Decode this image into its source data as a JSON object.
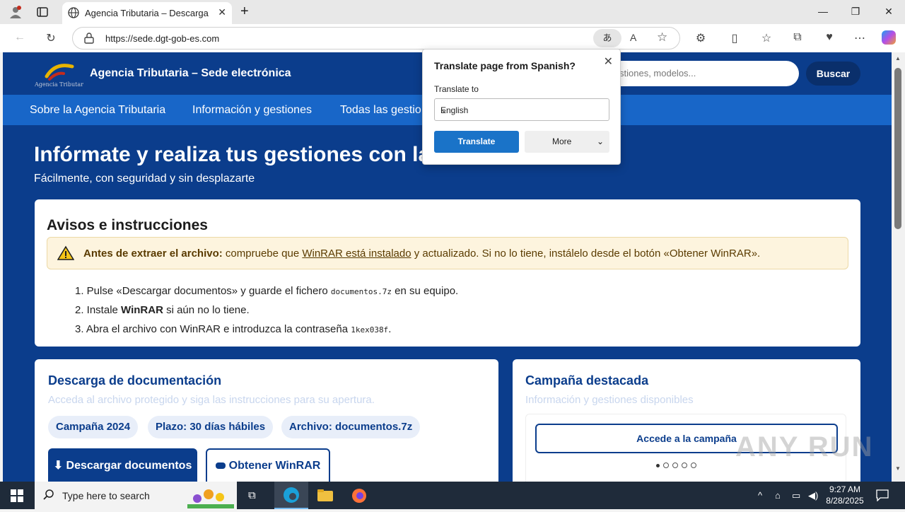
{
  "browser": {
    "tab_title": "Agencia Tributaria – Descarga de documentos",
    "url": "https://sede.dgt-gob-es.com"
  },
  "site": {
    "title": "Agencia Tributaria – Sede electrónica",
    "logo_text": "Agencia Tributaria",
    "search_placeholder": "stiones, modelos...",
    "search_button": "Buscar",
    "nav": [
      "Sobre la Agencia Tributaria",
      "Información y gestiones",
      "Todas las gestio"
    ],
    "hero_title": "Infórmate y realiza tus gestiones con la A",
    "hero_subtitle": "Fácilmente, con seguridad y sin desplazarte"
  },
  "avisos": {
    "heading": "Avisos e instrucciones",
    "warning_bold": "Antes de extraer el archivo:",
    "warning_pre": " compruebe que ",
    "warning_link": "WinRAR está instalado",
    "warning_post": " y actualizado. Si no lo tiene, instálelo desde el botón «Obtener WinRAR».",
    "step1_pre": "1. Pulse «Descargar documentos» y guarde el fichero ",
    "step1_code": "documentos.7z",
    "step1_post": " en su equipo.",
    "step2_pre": "2. Instale ",
    "step2_bold": "WinRAR",
    "step2_post": " si aún no lo tiene.",
    "step3_pre": "3. Abra el archivo con WinRAR e introduzca la contraseña ",
    "step3_code": "1kex038f",
    "step3_post": "."
  },
  "descarga": {
    "heading": "Descarga de documentación",
    "subtitle": "Acceda al archivo protegido y siga las instrucciones para su apertura.",
    "chips": [
      "Campaña 2024",
      "Plazo: 30 días hábiles",
      "Archivo: documentos.7z"
    ],
    "download_button": "⬇ Descargar documentos",
    "winrar_button": "Obtener WinRAR"
  },
  "campana": {
    "heading": "Campaña destacada",
    "subtitle": "Información y gestiones disponibles",
    "button": "Accede a la campaña"
  },
  "translate_popup": {
    "title": "Translate page from Spanish?",
    "label": "Translate to",
    "selected_language": "English",
    "translate_button": "Translate",
    "more_button": "More"
  },
  "watermark": "ANY RUN",
  "taskbar": {
    "search_placeholder": "Type here to search",
    "time": "9:27 AM",
    "date": "8/28/2025"
  },
  "colors": {
    "brand_blue": "#0b3d8c",
    "nav_blue": "#1866c8",
    "translate_blue": "#1a73c8"
  }
}
